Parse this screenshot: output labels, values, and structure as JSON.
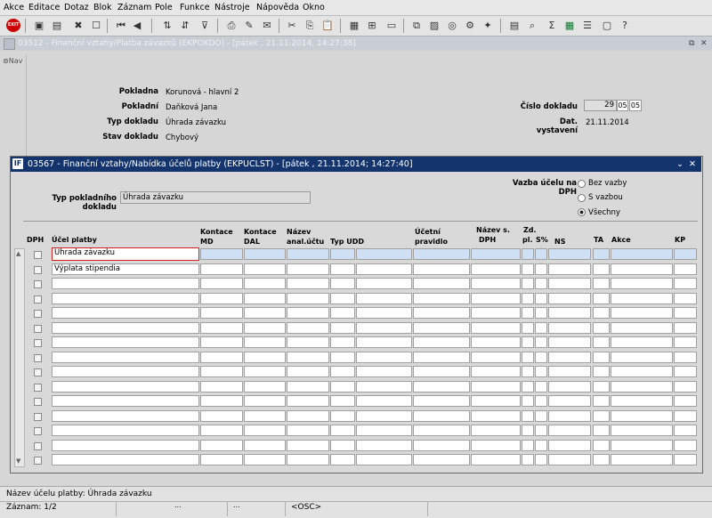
{
  "menu": [
    "Akce",
    "Editace",
    "Dotaz",
    "Blok",
    "Záznam",
    "Pole",
    "Funkce",
    "Nástroje",
    "Nápověda",
    "Okno"
  ],
  "toolbar": {
    "exit_label": "EXIT"
  },
  "main_window": {
    "title": "03512 - Finanční vztahy/Platba závazků (EKPOKDO) - [pátek  , 21.11.2014, 14:27:38]",
    "nav_label": "Nav",
    "fields": {
      "pokladna_label": "Pokladna",
      "pokladna_value": "Korunová - hlavní 2",
      "pokladni_label": "Pokladní",
      "pokladni_value": "Daňková Jana",
      "typ_dokladu_label": "Typ dokladu",
      "typ_dokladu_value": "Úhrada závazku",
      "stav_dokladu_label": "Stav dokladu",
      "stav_dokladu_value": "Chybový",
      "cislo_dokladu_label": "Číslo dokladu",
      "cislo_dokladu_1": "29",
      "cislo_dokladu_2": "05",
      "cislo_dokladu_3": "05",
      "dat_vystaveni_label": "Dat. vystavení",
      "dat_vystaveni_value": "21.11.2014"
    }
  },
  "dialog": {
    "title": "03567 - Finanční vztahy/Nabídka účelů platby (EKPUCLST) - [pátek  , 21.11.2014; 14:27:40]",
    "typ_label": "Typ pokladního dokladu",
    "typ_value": "Úhrada závazku",
    "vazba_label": "Vazba účelu na DPH",
    "radio": [
      "Bez vazby",
      "S vazbou",
      "Všechny"
    ],
    "radio_selected": 2,
    "columns": {
      "dph": "DPH",
      "ucel": "Účel platby",
      "kontace_md_1": "Kontace",
      "kontace_md_2": "MD",
      "kontace_dal_1": "Kontace",
      "kontace_dal_2": "DAL",
      "nazev_1": "Název",
      "nazev_2": "anal.účtu",
      "typ_udd": "Typ UDD",
      "ucetni_1": "Účetní",
      "ucetni_2": "pravidlo",
      "nazev_s_1": "Název s.",
      "nazev_s_2": "DPH",
      "zd_1": "Zd.",
      "zd_2": "pl.",
      "s": "S%",
      "ns": "NS",
      "ta": "TA",
      "akce": "Akce",
      "kp": "KP"
    },
    "rows": [
      "Úhrada závazku",
      "Výplata stipendia",
      "",
      "",
      "",
      "",
      "",
      "",
      "",
      "",
      "",
      "",
      "",
      "",
      ""
    ]
  },
  "status": {
    "message": "Název účelu platby: Úhrada závazku",
    "record": "Záznam: 1/2",
    "osc": "<OSC>"
  }
}
